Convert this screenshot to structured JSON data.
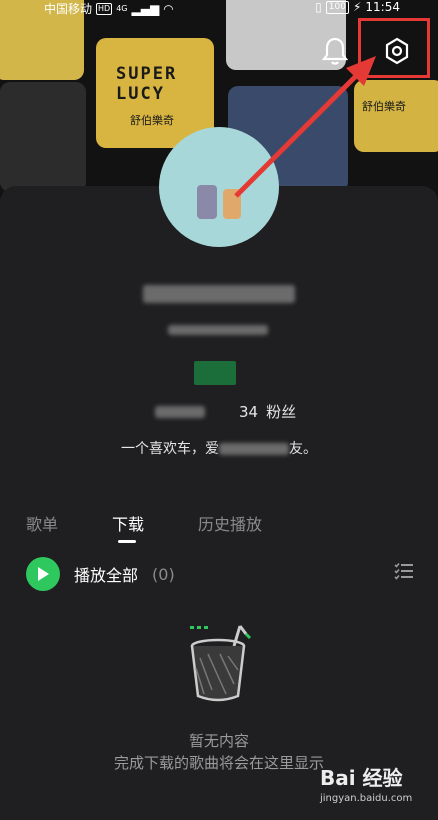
{
  "status_bar": {
    "carrier": "中国移动",
    "hd": "HD",
    "network": "4G",
    "battery": "100",
    "time": "11:54"
  },
  "background": {
    "album1_title": "SUPER LUCY",
    "album1_subtitle": "舒伯樂奇",
    "album2_title": "SUPER LUCY",
    "album2_subtitle": "舒伯樂奇",
    "album3_subtitle": "舒伯樂奇"
  },
  "header": {
    "bell_icon": "bell-icon",
    "settings_icon": "settings-icon"
  },
  "profile": {
    "followers_count": "34",
    "followers_label": "粉丝",
    "bio_prefix": "一个喜欢车，爱",
    "bio_suffix": "友。"
  },
  "tabs": [
    "歌单",
    "下载",
    "历史播放"
  ],
  "active_tab": "下载",
  "play_all": {
    "label": "播放全部",
    "count": "(0)"
  },
  "empty_state": {
    "title": "暂无内容",
    "message": "完成下载的歌曲将会在这里显示"
  },
  "watermark": {
    "brand": "Bai 经验",
    "url": "jingyan.baidu.com"
  },
  "colors": {
    "accent_green": "#2ec85f",
    "annotation_red": "#e53935",
    "panel_bg": "#1f1f21"
  }
}
